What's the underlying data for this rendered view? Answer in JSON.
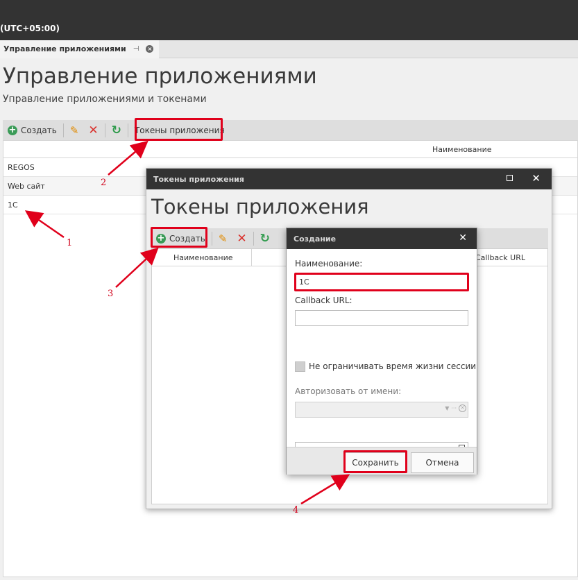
{
  "header": {
    "timezone": "(UTC+05:00)"
  },
  "doc_tab": {
    "label": "Управление приложениями",
    "pin_glyph": "⊣",
    "close_glyph": "×"
  },
  "page": {
    "title": "Управление приложениями",
    "subtitle": "Управление приложениями и токенами"
  },
  "toolbar": {
    "create_label": "Создать",
    "tokens_label": "Токены приложения"
  },
  "grid": {
    "column_name": "Наименование",
    "rows": [
      "REGOS",
      "Web сайт",
      "1С"
    ]
  },
  "tokens_dialog": {
    "window_title": "Токены приложения",
    "heading": "Токены приложения",
    "create_label": "Создать",
    "columns": [
      "Наименование",
      "Callback URL"
    ]
  },
  "create_dialog": {
    "window_title": "Создание",
    "name_label": "Наименование:",
    "name_value": "1С",
    "callback_label": "Callback URL:",
    "callback_value": "",
    "unlimited_session_label": "Не ограничивать время жизни сессии",
    "unlimited_session_checked": false,
    "authorize_as_label": "Авторизовать от имени:",
    "authorize_as_value": "",
    "token_value": "",
    "save_label": "Сохранить",
    "cancel_label": "Отмена"
  },
  "annotations": [
    "1",
    "2",
    "3",
    "4"
  ],
  "colors": {
    "highlight": "#e0001b",
    "titlebar": "#333333",
    "accent_green": "#3a9b57"
  }
}
